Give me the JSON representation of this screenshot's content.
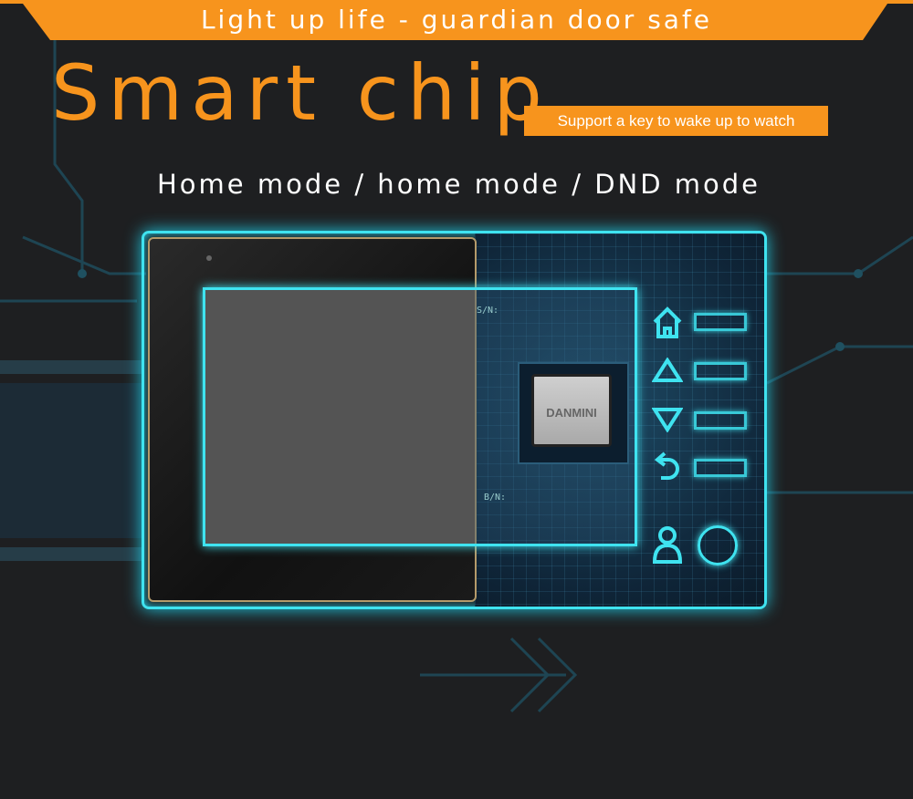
{
  "banner": {
    "text": "Light up life - guardian door safe"
  },
  "headline": {
    "title": "Smart chip",
    "badge": "Support a key to wake up to watch"
  },
  "modes": {
    "text": "Home mode / home mode / DND mode"
  },
  "device": {
    "chip_label": "DANMINI",
    "board_labels": [
      "S/N:",
      "B/N:"
    ],
    "buttons": [
      "home-icon",
      "up-arrow-icon",
      "down-arrow-icon",
      "back-icon",
      "user-icon",
      "circle-button-icon"
    ]
  },
  "colors": {
    "accent": "#f7941d",
    "glow": "#3fe3f0",
    "background": "#1e1f21"
  }
}
